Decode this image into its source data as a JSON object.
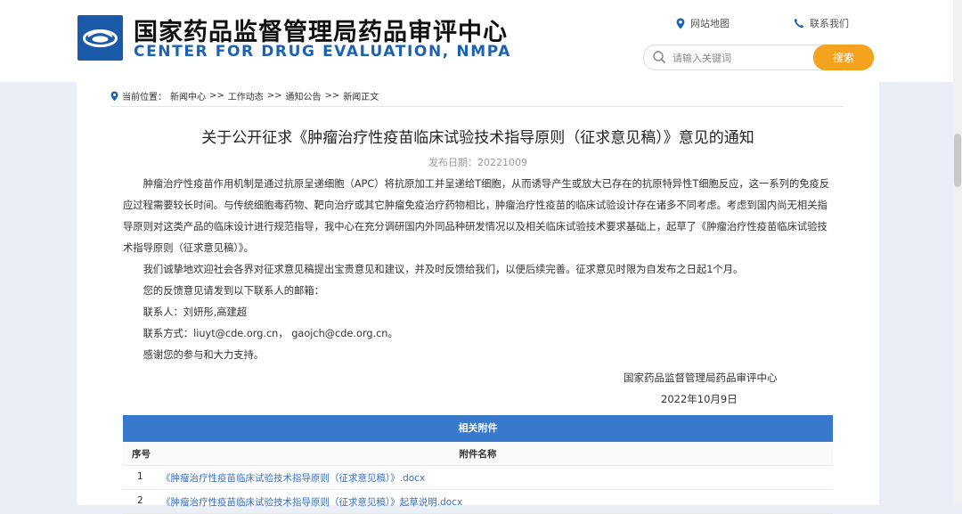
{
  "header": {
    "title_cn": "国家药品监督管理局药品审评中心",
    "title_en": "CENTER FOR DRUG EVALUATION, NMPA",
    "links": {
      "sitemap": "网站地图",
      "contact": "联系我们"
    },
    "search": {
      "placeholder": "请输入关键词",
      "value": "",
      "button": "搜索"
    }
  },
  "breadcrumb": {
    "label": "当前位置：",
    "items": [
      "新闻中心",
      "工作动态",
      "通知公告",
      "新闻正文"
    ],
    "sep": ">>"
  },
  "article": {
    "title": "关于公开征求《肿瘤治疗性疫苗临床试验技术指导原则（征求意见稿）》意见的通知",
    "date_label": "发布日期：",
    "date": "20221009",
    "paragraphs": [
      "肿瘤治疗性疫苗作用机制是通过抗原呈递细胞（APC）将抗原加工并呈递给T细胞，从而诱导产生或放大已存在的抗原特异性T细胞反应，这一系列的免疫反应过程需要较长时间。与传统细胞毒药物、靶向治疗或其它肿瘤免疫治疗药物相比，肿瘤治疗性疫苗的临床试验设计存在诸多不同考虑。考虑到国内尚无相关指导原则对这类产品的临床设计进行规范指导，我中心在充分调研国内外同品种研发情况以及相关临床试验技术要求基础上，起草了《肿瘤治疗性疫苗临床试验技术指导原则（征求意见稿）》。",
      "我们诚挚地欢迎社会各界对征求意见稿提出宝贵意见和建议，并及时反馈给我们，以便后续完善。征求意见时限为自发布之日起1个月。",
      "您的反馈意见请发到以下联系人的邮箱：",
      "联系人：刘妍彤,高建超",
      "联系方式：liuyt@cde.org.cn， gaojch@cde.org.cn。",
      "感谢您的参与和大力支持。"
    ],
    "signoff_org": "国家药品监督管理局药品审评中心",
    "signoff_date": "2022年10月9日"
  },
  "attachments": {
    "header": "相关附件",
    "col_no": "序号",
    "col_name": "附件名称",
    "rows": [
      {
        "no": "1",
        "name": "《肿瘤治疗性疫苗临床试验技术指导原则（征求意见稿）》.docx"
      },
      {
        "no": "2",
        "name": "《肿瘤治疗性疫苗临床试验技术指导原则（征求意见稿）》起草说明.docx"
      }
    ]
  },
  "colors": {
    "brand_blue": "#1c62b4",
    "search_orange": "#f5a21f",
    "attach_header": "#3878cd",
    "link_blue": "#3a6fc2"
  }
}
